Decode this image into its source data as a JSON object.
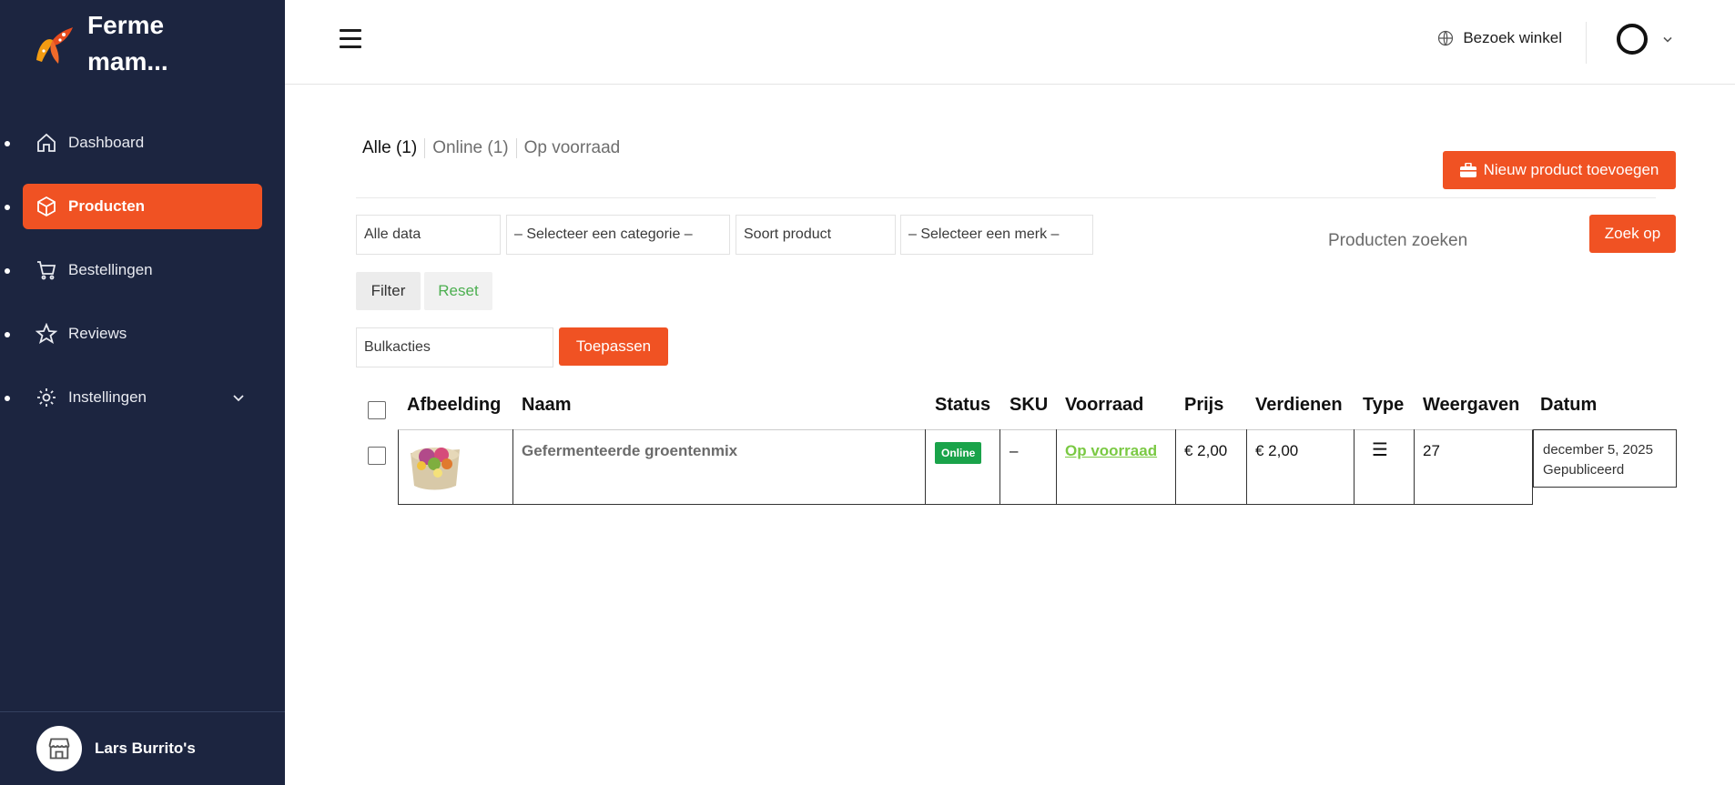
{
  "brand": {
    "name": "Ferme mam...",
    "logo_icon": "star-burst-logo",
    "accent": "#f05223"
  },
  "sidebar": {
    "items": [
      {
        "label": "Dashboard",
        "icon": "home-icon",
        "active": false
      },
      {
        "label": "Producten",
        "icon": "box-icon",
        "active": true
      },
      {
        "label": "Bestellingen",
        "icon": "cart-icon",
        "active": false
      },
      {
        "label": "Reviews",
        "icon": "star-icon",
        "active": false
      },
      {
        "label": "Instellingen",
        "icon": "gear-icon",
        "active": false,
        "expandable": true
      }
    ],
    "user": {
      "name": "Lars Burrito's",
      "icon": "store-icon"
    }
  },
  "header": {
    "menu_icon": "hamburger-icon",
    "visit_label": "Bezoek winkel",
    "visit_icon": "globe-icon",
    "profile_icon": "chevron-down-icon"
  },
  "tabs": [
    {
      "label": "Alle (1)",
      "active": true
    },
    {
      "label": "Online (1)",
      "active": false
    },
    {
      "label": "Op voorraad",
      "active": false
    }
  ],
  "actions": {
    "new_product_label": "Nieuw product toevoegen",
    "new_product_icon": "briefcase-icon"
  },
  "filters": {
    "date": "Alle data",
    "category": "– Selecteer een categorie –",
    "product_type": "Soort product",
    "brand": "– Selecteer een merk –",
    "search_placeholder": "Producten zoeken",
    "search_button": "Zoek op",
    "filter_button": "Filter",
    "reset_button": "Reset"
  },
  "bulk": {
    "select_label": "Bulkacties",
    "apply_label": "Toepassen"
  },
  "table": {
    "columns": [
      "Afbeelding",
      "Naam",
      "Status",
      "SKU",
      "Voorraad",
      "Prijs",
      "Verdienen",
      "Type",
      "Weergaven",
      "Datum"
    ],
    "rows": [
      {
        "name": "Gefermenteerde groentenmix",
        "status": "Online",
        "sku": "–",
        "stock": "Op voorraad",
        "price": "€ 2,00",
        "earnings": "€ 2,00",
        "type_icon": "list-icon",
        "type_glyph": "☰",
        "views": "27",
        "date": "december 5, 2025",
        "date_status": "Gepubliceerd"
      }
    ]
  }
}
